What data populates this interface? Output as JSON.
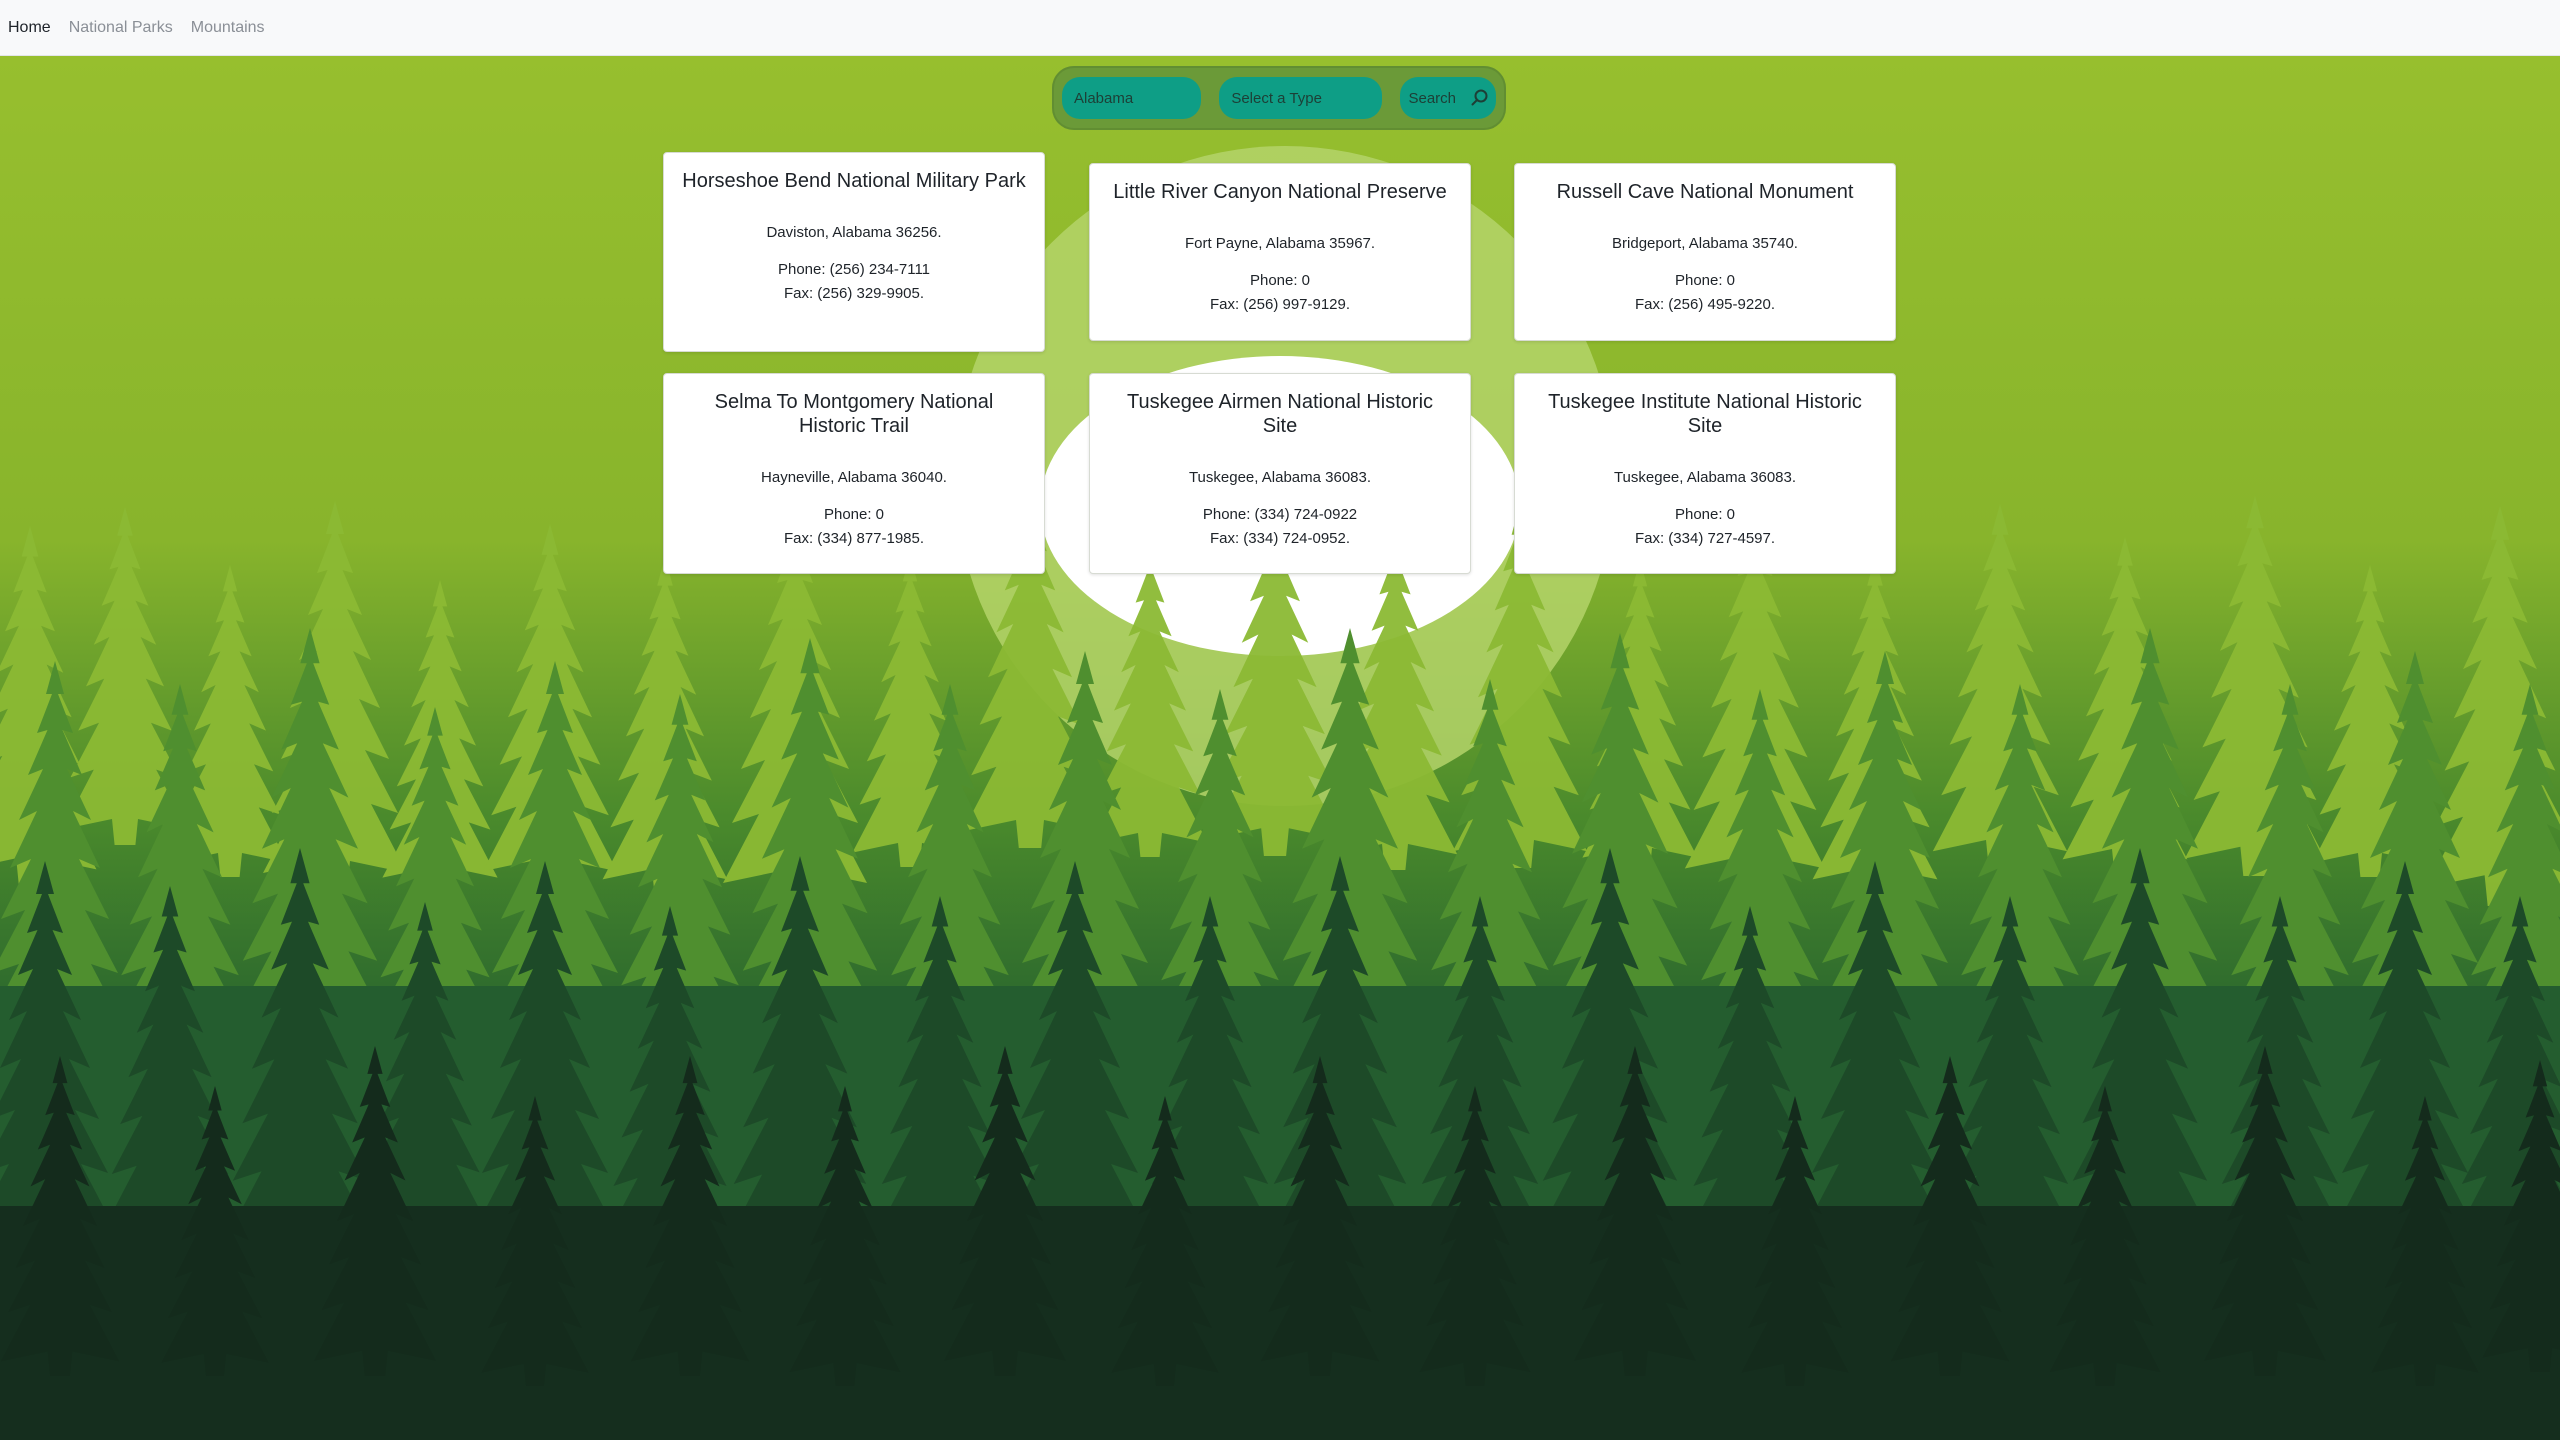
{
  "nav": {
    "links": [
      {
        "label": "Home",
        "active": true
      },
      {
        "label": "National Parks",
        "active": false
      },
      {
        "label": "Mountains",
        "active": false
      }
    ]
  },
  "search": {
    "state_value": "Alabama",
    "type_placeholder": "Select a Type",
    "button_label": "Search",
    "icon": "search-icon"
  },
  "parks": [
    {
      "name": "Horseshoe Bend National Military Park",
      "address": "Daviston, Alabama 36256.",
      "phone": "Phone: (256) 234-7111",
      "fax": "Fax: (256) 329-9905."
    },
    {
      "name": "Little River Canyon National Preserve",
      "address": "Fort Payne, Alabama 35967.",
      "phone": "Phone: 0",
      "fax": "Fax: (256) 997-9129."
    },
    {
      "name": "Russell Cave National Monument",
      "address": "Bridgeport, Alabama 35740.",
      "phone": "Phone: 0",
      "fax": "Fax: (256) 495-9220."
    },
    {
      "name": "Selma To Montgomery National Historic Trail",
      "address": "Hayneville, Alabama 36040.",
      "phone": "Phone: 0",
      "fax": "Fax: (334) 877-1985."
    },
    {
      "name": "Tuskegee Airmen National Historic Site",
      "address": "Tuskegee, Alabama 36083.",
      "phone": "Phone: (334) 724-0922",
      "fax": "Fax: (334) 724-0952."
    },
    {
      "name": "Tuskegee Institute National Historic Site",
      "address": "Tuskegee, Alabama 36083.",
      "phone": "Phone: 0",
      "fax": "Fax: (334) 727-4597."
    }
  ],
  "colors": {
    "nav_bg": "#f8f9fa",
    "search_pill": "#0e9e86",
    "search_bar": "#6b9a38",
    "sky_top": "#9cc030",
    "forest_dark": "#142b1c"
  }
}
